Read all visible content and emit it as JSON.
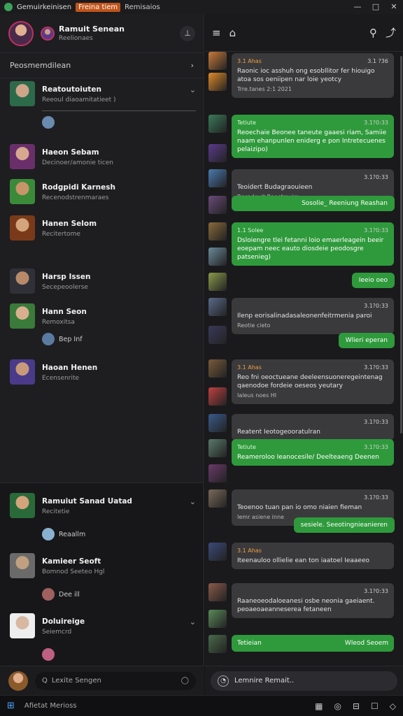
{
  "titlebar": {
    "app": "Gemuirkeinisen",
    "tag": "Freina tiem",
    "extra": "Remisaios",
    "min": "—",
    "max": "□",
    "close": "✕"
  },
  "profile": {
    "name": "Ramuit Senean",
    "status": "Reelionaes",
    "action": "⊥"
  },
  "sidebar": {
    "section": "Peosmemdilean",
    "section_chevron": "›",
    "conversations": [
      {
        "name": "Reatoutoiuten",
        "preview": "Reeoul diaoamitatieet )",
        "chevron": "⌄",
        "colors": [
          "#cfa58a",
          "#2d6a4a"
        ]
      },
      {
        "name": "Haeon Sebam",
        "preview": "Decinoer/amonie ticen",
        "colors": [
          "#d7a890",
          "#6a2f6a"
        ]
      },
      {
        "name": "Rodgpidi Karnesh",
        "preview": "Recenodstrenmaraes",
        "colors": [
          "#c8956a",
          "#3a8a3a"
        ]
      },
      {
        "name": "Hanen Selom",
        "preview": "Recitertome",
        "colors": [
          "#d4a47c",
          "#7a3a1a"
        ]
      },
      {
        "name": "Harsp Issen",
        "preview": "Secepeoolerse",
        "colors": [
          "#b88a6a",
          "#303038"
        ]
      },
      {
        "name": "Hann Seon",
        "preview": "Remoxitsa",
        "colors": [
          "#d8b090",
          "#3a7a3a"
        ]
      },
      {
        "name": "Haoan Henen",
        "preview": "Ecensenrite",
        "colors": [
          "#c89a7a",
          "#4a3a8a"
        ]
      }
    ],
    "subrows": [
      {
        "label": "",
        "color": "#6a8ab0"
      },
      {
        "label": "Bep Inf",
        "color": "#5a7aa0"
      }
    ],
    "pinned": [
      {
        "name": "Ramuiut Sanad Uatad",
        "preview": "Recitetie",
        "chevron": "⌄",
        "colors": [
          "#d4a47c",
          "#2a6a3a"
        ]
      },
      {
        "name": "Kamieer Seoft",
        "preview": "Bomnod Seeteo Hgl",
        "colors": [
          "#c0a080",
          "#6a6a6a"
        ]
      },
      {
        "name": "Doluireige",
        "preview": "Seiemcrd",
        "chevron": "⌄",
        "colors": [
          "#d8b8a0",
          "#eeeeee"
        ]
      }
    ],
    "pinned_subrows": [
      {
        "label": "Reaallm",
        "color": "#8ab0d0"
      },
      {
        "label": "Dee ill",
        "color": "#a06060"
      },
      {
        "label": "",
        "color": "#c06080"
      }
    ]
  },
  "left_composer": {
    "placeholder": "Lexite Sengen",
    "search_icon": "Q",
    "mic_icon": "◯"
  },
  "chat": {
    "header_icons": [
      "≡",
      "⌂",
      "⚲",
      "⤴"
    ],
    "messages": [
      {
        "type": "grey",
        "sender": "3.1 Ahas",
        "time": "3.1 ?36",
        "text": "Raonic ioc asshuh ong esobllitor fer hiouigo atoa sos oeniipen nar loie yeotcy",
        "foot": "Trre.tanes 2:1 2021"
      },
      {
        "type": "green",
        "sender": "Tetiute",
        "time": "3.1?0:33",
        "text": "Reoechaie Beonee taneute gaaesi riam, Samiie naam ehanpunlen eniderg e pon Intretecuenes pelaizipo)"
      },
      {
        "type": "grey",
        "sender": "",
        "time": "3.1?0:33",
        "text": "Teoidert Budagraouieen",
        "foot": "Recndeuit Reeotmuim"
      },
      {
        "type": "green-pill",
        "text": "Sosolie_ Reeniung Reashan"
      },
      {
        "type": "green",
        "sender": "1.1 Solee",
        "time": "3.1?0:33",
        "text": "Dsloiengre tlei fetanni loio emaerleagein beeir eoepam neec eauto diosdeie peodosgre patsenieg)"
      },
      {
        "type": "green-pill",
        "text": "Ieeio oeo"
      },
      {
        "type": "grey",
        "sender": "",
        "time": "3.1?0:33",
        "text": "Ilenp eorisalinadasaleonenfeitrmenia paroi",
        "foot": "Reotie cieto"
      },
      {
        "type": "green-pill",
        "text": "Wlieri eperan"
      },
      {
        "type": "grey",
        "sender": "3.1 Ahas",
        "time": "3.1?0:33",
        "text": "Reo fni oeoctueane deeleensuoneregeintenag qaenodoe fordeie oeseos yeutary",
        "foot": "Ialeus noes HI"
      },
      {
        "type": "grey",
        "sender": "",
        "time": "3.1?0:33",
        "text": "Reatent Ieotogeooratulran"
      },
      {
        "type": "green",
        "sender": "Tetiute",
        "time": "3.1?0:33",
        "text": "Reameroloo Ieanocesile/ Deelteaeng Deenen"
      },
      {
        "type": "grey",
        "sender": "",
        "time": "3.1?0:33",
        "text": "Teoenoo tuan pan io omo niaien fieman",
        "foot": "Iemr asiene inne"
      },
      {
        "type": "green-pill",
        "text": "sesiele. Seeotingnieanieren"
      },
      {
        "type": "grey",
        "sender": "3.1 Ahas",
        "time": "",
        "text": "Iteenauloo ollielie ean ton iaatoel Ieaaeeo"
      },
      {
        "type": "grey",
        "sender": "",
        "time": "3.1?0:33",
        "text": "Raaneoeodaloeanesi osbe neonia gaeiaent. peoaeoaeanneserea fetaneen"
      },
      {
        "type": "green-row",
        "left": "Tetieian",
        "right": "Wleod Seoem"
      }
    ],
    "avatar_colors": [
      "#c87a3a",
      "#e08a2a",
      "#3a7a5a",
      "#5a3a8a",
      "#4a7ab0",
      "#6a4a7a",
      "#8a6a3a",
      "#6a8a9a",
      "#8a9a4a",
      "#5a6a8a",
      "#3a3a5a",
      "#7a5a3a",
      "#c04040",
      "#3a5a8a",
      "#5a7a6a",
      "#6a3a6a",
      "#7a6a5a",
      "#3a4a7a",
      "#8a5a4a",
      "#5a8a5a",
      "#4a6a4a"
    ]
  },
  "right_composer": {
    "placeholder": "Lemnire Remait..",
    "icon": "◔"
  },
  "taskbar": {
    "start": "⊞",
    "label": "Afietat Merioss",
    "icons": [
      "▦",
      "◎",
      "⊟",
      "☐",
      "◇"
    ]
  }
}
